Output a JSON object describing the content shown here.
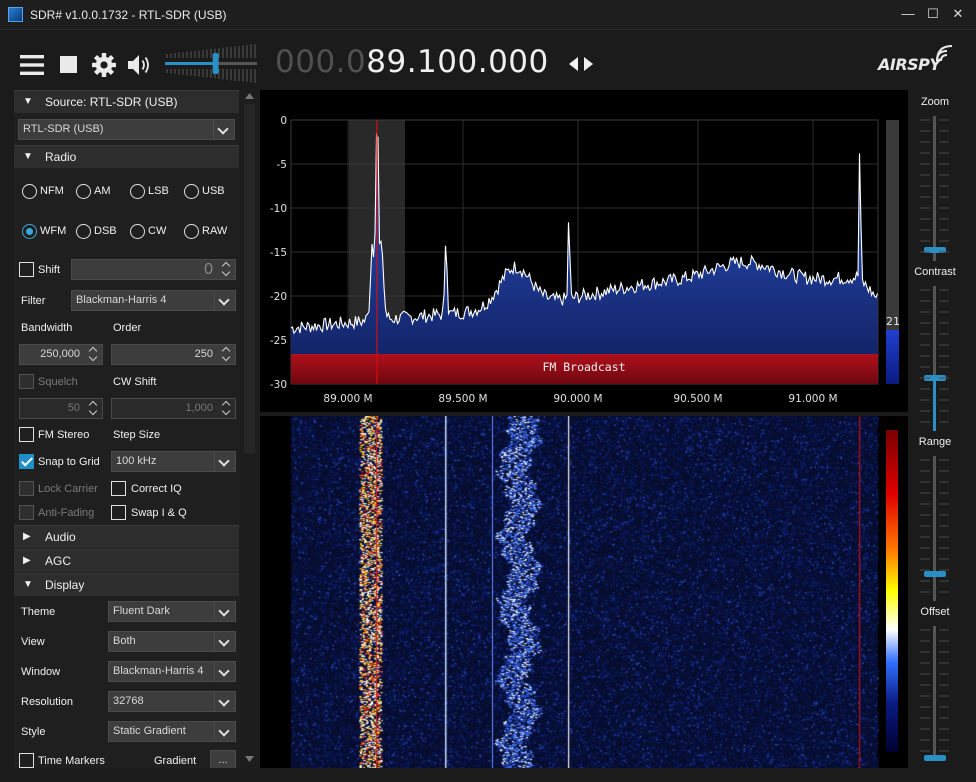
{
  "window": {
    "title": "SDR# v1.0.0.1732 - RTL-SDR (USB)",
    "minimize": "—",
    "maximize": "☐",
    "close": "✕"
  },
  "toolbar": {
    "icons": [
      "menu-icon",
      "stop-icon",
      "gear-icon",
      "speaker-icon"
    ],
    "volume_level": 0.55,
    "frequency_dim": "000.0",
    "frequency_bright": "89.100.000",
    "tuning_arrows": "◀▶",
    "logo": "AIRSPY"
  },
  "source": {
    "header": "Source: RTL-SDR (USB)",
    "device": "RTL-SDR (USB)"
  },
  "radio": {
    "header": "Radio",
    "modes_row1": [
      "NFM",
      "AM",
      "LSB",
      "USB"
    ],
    "modes_row2": [
      "WFM",
      "DSB",
      "CW",
      "RAW"
    ],
    "selected_mode": "WFM",
    "shift_label": "Shift",
    "shift_value": "0",
    "filter_label": "Filter",
    "filter_value": "Blackman-Harris 4",
    "bandwidth_label": "Bandwidth",
    "bandwidth_value": "250,000",
    "order_label": "Order",
    "order_value": "250",
    "squelch_label": "Squelch",
    "squelch_value": "50",
    "cw_shift_label": "CW Shift",
    "cw_shift_value": "1,000",
    "fm_stereo_label": "FM Stereo",
    "step_size_label": "Step Size",
    "snap_label": "Snap to Grid",
    "step_value": "100 kHz",
    "lock_carrier_label": "Lock Carrier",
    "correct_iq_label": "Correct IQ",
    "anti_fading_label": "Anti-Fading",
    "swap_iq_label": "Swap I & Q"
  },
  "collapsed": {
    "audio": "Audio",
    "agc": "AGC"
  },
  "display": {
    "header": "Display",
    "theme_label": "Theme",
    "theme_value": "Fluent Dark",
    "view_label": "View",
    "view_value": "Both",
    "window_label": "Window",
    "window_value": "Blackman-Harris 4",
    "resolution_label": "Resolution",
    "resolution_value": "32768",
    "style_label": "Style",
    "style_value": "Static Gradient",
    "time_markers_label": "Time Markers",
    "gradient_label": "Gradient",
    "gradient_button": "..."
  },
  "spectrum": {
    "y_ticks": [
      "0",
      "-5",
      "-10",
      "-15",
      "-20",
      "-25",
      "-30"
    ],
    "x_ticks": [
      "89.000 M",
      "89.500 M",
      "90.000 M",
      "90.500 M",
      "91.000 M"
    ],
    "band_label": "FM Broadcast",
    "level_readout": "21",
    "colors": {
      "fill_top": "#1a3a9a",
      "band": "#9b0b14",
      "cursor": "#d01010",
      "trace": "#ffffff"
    }
  },
  "right_controls": {
    "zoom_label": "Zoom",
    "contrast_label": "Contrast",
    "range_label": "Range",
    "offset_label": "Offset"
  }
}
